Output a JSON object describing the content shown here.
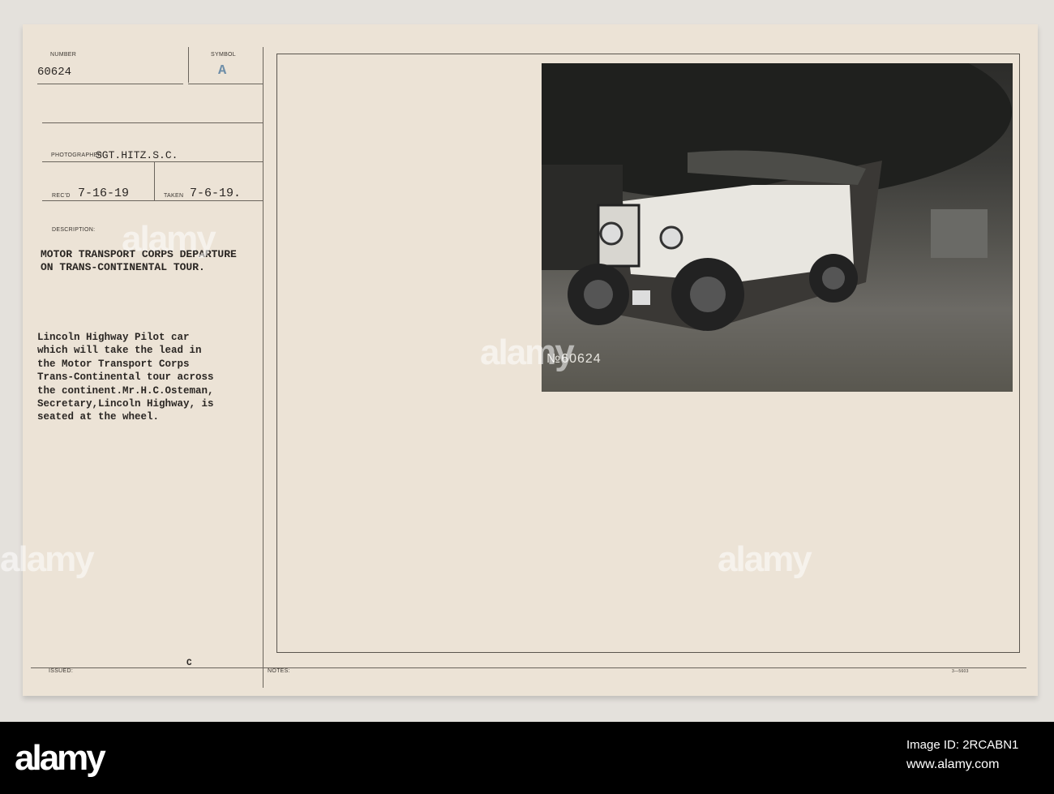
{
  "card": {
    "number_label": "NUMBER",
    "number": "60624",
    "symbol_label": "SYMBOL",
    "symbol": "A",
    "photographer_label": "PHOTOGRAPHER",
    "photographer": "SGT.HITZ.S.C.",
    "recd_label": "REC'D",
    "recd": "7-16-19",
    "taken_label": "TAKEN",
    "taken": "7-6-19.",
    "description_label": "DESCRIPTION:",
    "title": "MOTOR TRANSPORT CORPS DEPARTURE\nON TRANS-CONTINENTAL TOUR.",
    "caption": "Lincoln Highway Pilot car\nwhich will take the lead in\nthe Motor Transport Corps\nTrans-Continental tour across\nthe continent.Mr.H.C.Osteman,\nSecretary,Lincoln Highway, is\nseated at the wheel.",
    "issued_label": "ISSUED:",
    "issued_mark": "C",
    "notes_label": "NOTES:",
    "form_code": "3—5603",
    "photo_number": "№60624"
  },
  "watermark": {
    "logo": "alamy",
    "image_id": "Image ID: 2RCABN1",
    "url": "www.alamy.com"
  }
}
